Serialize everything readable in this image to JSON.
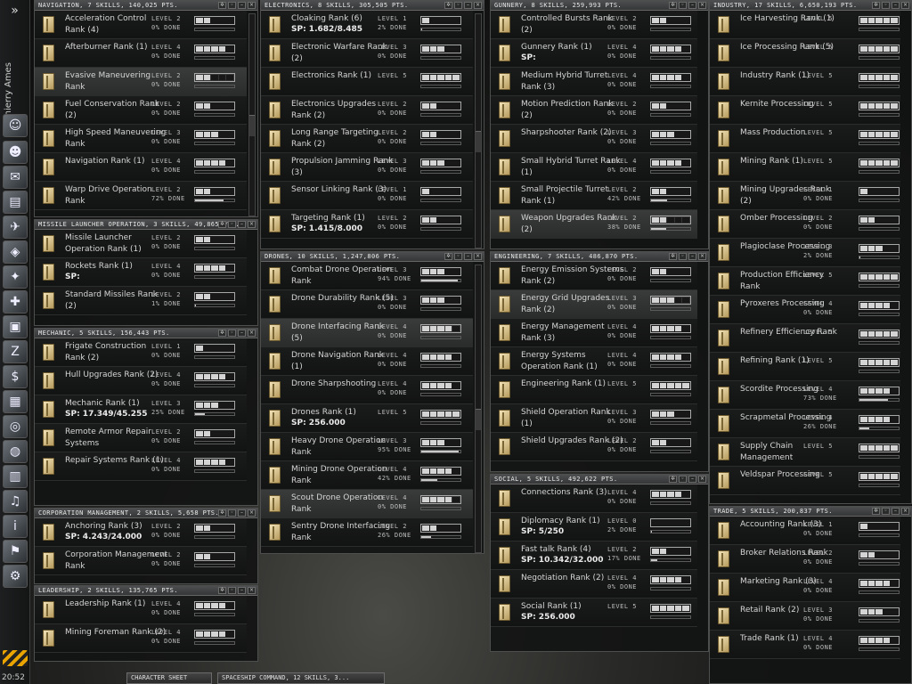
{
  "sidebar": {
    "character": "Thierry Ames",
    "clock": "20:52",
    "expand_icon": "chevron-double-right"
  },
  "taskbar": {
    "character_sheet": "CHARACTER SHEET",
    "spaceship": "SPACESHIP COMMAND, 12 SKILLS, 3..."
  },
  "groups": {
    "navigation": {
      "title": "NAVIGATION, 7 SKILLS, 140,025 PTS.",
      "skills": [
        {
          "name": "Acceleration Control Rank (4)",
          "level": "LEVEL 2",
          "done": "0% DONE",
          "lv": 2
        },
        {
          "name": "Afterburner Rank (1)",
          "level": "LEVEL 4",
          "done": "0% DONE",
          "lv": 4
        },
        {
          "name": "Evasive Maneuvering Rank",
          "level": "LEVEL 2",
          "done": "0% DONE",
          "lv": 2,
          "sel": true
        },
        {
          "name": "Fuel Conservation Rank (2)",
          "level": "LEVEL 2",
          "done": "0% DONE",
          "lv": 2
        },
        {
          "name": "High Speed Maneuvering Rank",
          "level": "LEVEL 3",
          "done": "0% DONE",
          "lv": 3
        },
        {
          "name": "Navigation Rank (1)",
          "level": "LEVEL 4",
          "done": "0% DONE",
          "lv": 4
        },
        {
          "name": "Warp Drive Operation Rank",
          "level": "LEVEL 2",
          "done": "72% DONE",
          "lv": 2,
          "pct": 72
        }
      ]
    },
    "missile": {
      "title": "MISSILE LAUNCHER OPERATION, 3 SKILLS, 49,865 PTS.",
      "skills": [
        {
          "name": "Missile Launcher Operation Rank (1)",
          "level": "LEVEL 2",
          "done": "0% DONE",
          "lv": 2
        },
        {
          "name": "Rockets Rank (1)",
          "sp": "SP:",
          "level": "LEVEL 4",
          "done": "0% DONE",
          "lv": 4
        },
        {
          "name": "Standard Missiles Rank (2)",
          "level": "LEVEL 2",
          "done": "1% DONE",
          "lv": 2,
          "pct": 1
        }
      ]
    },
    "mechanic": {
      "title": "MECHANIC, 5 SKILLS, 156,443 PTS.",
      "skills": [
        {
          "name": "Frigate Construction Rank (2)",
          "level": "LEVEL 1",
          "done": "0% DONE",
          "lv": 1
        },
        {
          "name": "Hull Upgrades Rank (2)",
          "level": "LEVEL 4",
          "done": "0% DONE",
          "lv": 4
        },
        {
          "name": "Mechanic Rank (1)",
          "sp": "SP: 17.349/45.255",
          "level": "LEVEL 3",
          "done": "25% DONE",
          "lv": 3,
          "pct": 25
        },
        {
          "name": "Remote Armor Repair Systems",
          "level": "LEVEL 2",
          "done": "0% DONE",
          "lv": 2
        },
        {
          "name": "Repair Systems Rank (1)",
          "level": "LEVEL 4",
          "done": "0% DONE",
          "lv": 4
        }
      ]
    },
    "corporation": {
      "title": "CORPORATION MANAGEMENT, 2 SKILLS, 5,658 PTS.",
      "skills": [
        {
          "name": "Anchoring Rank (3)",
          "sp": "SP: 4.243/24.000",
          "level": "LEVEL 2",
          "done": "0% DONE",
          "lv": 2
        },
        {
          "name": "Corporation Management Rank",
          "level": "LEVEL 2",
          "done": "0% DONE",
          "lv": 2
        }
      ]
    },
    "leadership": {
      "title": "LEADERSHIP, 2 SKILLS, 135,765 PTS.",
      "skills": [
        {
          "name": "Leadership Rank (1)",
          "level": "LEVEL 4",
          "done": "0% DONE",
          "lv": 4
        },
        {
          "name": "Mining Foreman Rank (2)",
          "level": "LEVEL 4",
          "done": "0% DONE",
          "lv": 4
        }
      ]
    },
    "electronics": {
      "title": "ELECTRONICS, 8 SKILLS, 305,505 PTS.",
      "skills": [
        {
          "name": "Cloaking Rank (6)",
          "sp": "SP: 1.682/8.485",
          "level": "LEVEL 1",
          "done": "2% DONE",
          "lv": 1,
          "pct": 2
        },
        {
          "name": "Electronic Warfare Rank (2)",
          "level": "LEVEL 3",
          "done": "0% DONE",
          "lv": 3
        },
        {
          "name": "Electronics Rank (1)",
          "level": "LEVEL 5",
          "done": "",
          "lv": 5
        },
        {
          "name": "Electronics Upgrades Rank (2)",
          "level": "LEVEL 2",
          "done": "0% DONE",
          "lv": 2
        },
        {
          "name": "Long Range Targeting Rank (2)",
          "level": "LEVEL 2",
          "done": "0% DONE",
          "lv": 2
        },
        {
          "name": "Propulsion Jamming Rank (3)",
          "level": "LEVEL 3",
          "done": "0% DONE",
          "lv": 3
        },
        {
          "name": "Sensor Linking Rank (3)",
          "level": "LEVEL 1",
          "done": "0% DONE",
          "lv": 1
        },
        {
          "name": "Targeting Rank (1)",
          "sp": "SP: 1.415/8.000",
          "level": "LEVEL 2",
          "done": "0% DONE",
          "lv": 2
        }
      ]
    },
    "drones": {
      "title": "DRONES, 10 SKILLS, 1,247,806 PTS.",
      "skills": [
        {
          "name": "Combat Drone Operation Rank",
          "level": "LEVEL 3",
          "done": "94% DONE",
          "lv": 3,
          "pct": 94
        },
        {
          "name": "Drone Durability Rank (5)",
          "level": "LEVEL 3",
          "done": "0% DONE",
          "lv": 3
        },
        {
          "name": "Drone Interfacing Rank (5)",
          "level": "LEVEL 4",
          "done": "0% DONE",
          "lv": 4,
          "sel": true
        },
        {
          "name": "Drone Navigation Rank (1)",
          "level": "LEVEL 4",
          "done": "0% DONE",
          "lv": 4
        },
        {
          "name": "Drone Sharpshooting",
          "level": "LEVEL 4",
          "done": "0% DONE",
          "lv": 4
        },
        {
          "name": "Drones Rank (1)",
          "sp": "SP: 256.000",
          "level": "LEVEL 5",
          "done": "",
          "lv": 5
        },
        {
          "name": "Heavy Drone Operation Rank",
          "level": "LEVEL 3",
          "done": "95% DONE",
          "lv": 3,
          "pct": 95
        },
        {
          "name": "Mining Drone Operation Rank",
          "level": "LEVEL 4",
          "done": "42% DONE",
          "lv": 4,
          "pct": 42
        },
        {
          "name": "Scout Drone Operation Rank",
          "level": "LEVEL 4",
          "done": "0% DONE",
          "lv": 4,
          "sel": true
        },
        {
          "name": "Sentry Drone Interfacing Rank",
          "level": "LEVEL 2",
          "done": "26% DONE",
          "lv": 2,
          "pct": 26
        }
      ]
    },
    "gunnery": {
      "title": "GUNNERY, 8 SKILLS, 259,993 PTS.",
      "skills": [
        {
          "name": "Controlled Bursts Rank (2)",
          "level": "LEVEL 2",
          "done": "0% DONE",
          "lv": 2
        },
        {
          "name": "Gunnery Rank (1)",
          "sp": "SP:",
          "level": "LEVEL 4",
          "done": "0% DONE",
          "lv": 4
        },
        {
          "name": "Medium Hybrid Turret Rank (3)",
          "level": "LEVEL 4",
          "done": "0% DONE",
          "lv": 4
        },
        {
          "name": "Motion Prediction Rank (2)",
          "level": "LEVEL 2",
          "done": "0% DONE",
          "lv": 2
        },
        {
          "name": "Sharpshooter Rank (2)",
          "level": "LEVEL 3",
          "done": "0% DONE",
          "lv": 3
        },
        {
          "name": "Small Hybrid Turret Rank (1)",
          "level": "LEVEL 4",
          "done": "0% DONE",
          "lv": 4
        },
        {
          "name": "Small Projectile Turret Rank (1)",
          "level": "LEVEL 2",
          "done": "42% DONE",
          "lv": 2,
          "pct": 42
        },
        {
          "name": "Weapon Upgrades Rank (2)",
          "level": "LEVEL 2",
          "done": "38% DONE",
          "lv": 2,
          "pct": 38,
          "sel": true
        }
      ]
    },
    "engineering": {
      "title": "ENGINEERING, 7 SKILLS, 486,870 PTS.",
      "skills": [
        {
          "name": "Energy Emission Systems Rank (2)",
          "level": "LEVEL 2",
          "done": "0% DONE",
          "lv": 2
        },
        {
          "name": "Energy Grid Upgrades Rank (2)",
          "level": "LEVEL 3",
          "done": "0% DONE",
          "lv": 3,
          "sel": true
        },
        {
          "name": "Energy Management Rank (3)",
          "level": "LEVEL 4",
          "done": "0% DONE",
          "lv": 4
        },
        {
          "name": "Energy Systems Operation Rank (1)",
          "level": "LEVEL 4",
          "done": "0% DONE",
          "lv": 4
        },
        {
          "name": "Engineering Rank (1)",
          "level": "LEVEL 5",
          "done": "",
          "lv": 5
        },
        {
          "name": "Shield Operation Rank (1)",
          "level": "LEVEL 3",
          "done": "0% DONE",
          "lv": 3
        },
        {
          "name": "Shield Upgrades Rank (2)",
          "level": "LEVEL 2",
          "done": "0% DONE",
          "lv": 2
        }
      ]
    },
    "social": {
      "title": "SOCIAL, 5 SKILLS, 492,622 PTS.",
      "skills": [
        {
          "name": "Connections Rank (3)",
          "level": "LEVEL 4",
          "done": "0% DONE",
          "lv": 4
        },
        {
          "name": "Diplomacy Rank (1)",
          "sp": "SP: 5/250",
          "level": "LEVEL 0",
          "done": "2% DONE",
          "lv": 0,
          "pct": 2
        },
        {
          "name": "Fast talk Rank (4)",
          "sp": "SP: 10.342/32.000",
          "level": "LEVEL 2",
          "done": "17% DONE",
          "lv": 2,
          "pct": 17
        },
        {
          "name": "Negotiation Rank (2)",
          "level": "LEVEL 4",
          "done": "0% DONE",
          "lv": 4
        },
        {
          "name": "Social Rank (1)",
          "sp": "SP: 256.000",
          "level": "LEVEL 5",
          "done": "",
          "lv": 5
        }
      ]
    },
    "industry": {
      "title": "INDUSTRY, 17 SKILLS, 6,650,193 PTS.",
      "skills": [
        {
          "name": "Ice Harvesting Rank (1)",
          "level": "LEVEL 5",
          "done": "",
          "lv": 5
        },
        {
          "name": "Ice Processing Rank (5)",
          "level": "LEVEL 5",
          "done": "",
          "lv": 5
        },
        {
          "name": "Industry Rank (1)",
          "level": "LEVEL 5",
          "done": "",
          "lv": 5
        },
        {
          "name": "Kernite Processing",
          "level": "LEVEL 5",
          "done": "",
          "lv": 5
        },
        {
          "name": "Mass Production",
          "level": "LEVEL 5",
          "done": "",
          "lv": 5
        },
        {
          "name": "Mining Rank (1)",
          "level": "LEVEL 5",
          "done": "",
          "lv": 5
        },
        {
          "name": "Mining Upgrades Rank (2)",
          "level": "LEVEL 1",
          "done": "0% DONE",
          "lv": 1
        },
        {
          "name": "Omber Processing",
          "level": "LEVEL 2",
          "done": "0% DONE",
          "lv": 2
        },
        {
          "name": "Plagioclase Processing",
          "level": "LEVEL 3",
          "done": "2% DONE",
          "lv": 3,
          "pct": 2
        },
        {
          "name": "Production Efficiency Rank",
          "level": "LEVEL 5",
          "done": "",
          "lv": 5
        },
        {
          "name": "Pyroxeres Processing",
          "level": "LEVEL 4",
          "done": "0% DONE",
          "lv": 4
        },
        {
          "name": "Refinery Efficiency Rank",
          "level": "LEVEL 5",
          "done": "",
          "lv": 5
        },
        {
          "name": "Refining Rank (1)",
          "level": "LEVEL 5",
          "done": "",
          "lv": 5
        },
        {
          "name": "Scordite Processing",
          "level": "LEVEL 4",
          "done": "73% DONE",
          "lv": 4,
          "pct": 73
        },
        {
          "name": "Scrapmetal Processing",
          "level": "LEVEL 4",
          "done": "26% DONE",
          "lv": 4,
          "pct": 26
        },
        {
          "name": "Supply Chain Management",
          "level": "LEVEL 5",
          "done": "",
          "lv": 5
        },
        {
          "name": "Veldspar Processing",
          "level": "LEVEL 5",
          "done": "",
          "lv": 5
        }
      ]
    },
    "trade": {
      "title": "TRADE, 5 SKILLS, 200,837 PTS.",
      "skills": [
        {
          "name": "Accounting Rank (3)",
          "level": "LEVEL 1",
          "done": "0% DONE",
          "lv": 1
        },
        {
          "name": "Broker Relations Rank",
          "level": "LEVEL 2",
          "done": "0% DONE",
          "lv": 2
        },
        {
          "name": "Marketing Rank (3)",
          "level": "LEVEL 4",
          "done": "0% DONE",
          "lv": 4
        },
        {
          "name": "Retail Rank (2)",
          "level": "LEVEL 3",
          "done": "0% DONE",
          "lv": 3
        },
        {
          "name": "Trade Rank (1)",
          "level": "LEVEL 4",
          "done": "0% DONE",
          "lv": 4
        }
      ]
    }
  }
}
